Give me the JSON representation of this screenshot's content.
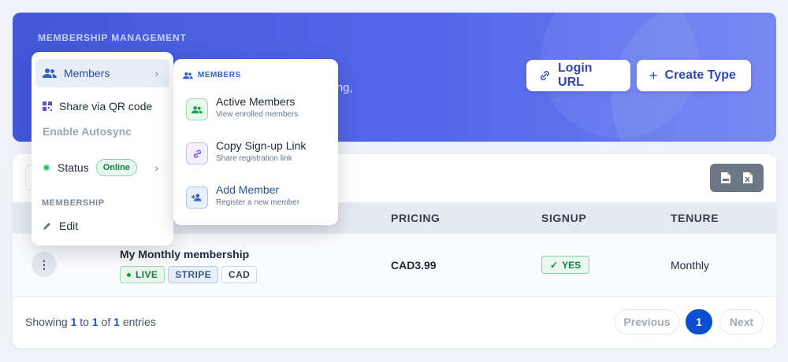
{
  "hero": {
    "eyebrow": "MEMBERSHIP MANAGEMENT",
    "description_fragment": "cing,",
    "login_label": "Login URL",
    "create_label": "Create Type"
  },
  "table": {
    "headers": [
      "PRICING",
      "SIGNUP",
      "TENURE"
    ],
    "rows": [
      {
        "name": "My Monthly membership",
        "badges": [
          "LIVE",
          "STRIPE",
          "CAD"
        ],
        "price": "CAD3.99",
        "signup": "YES",
        "tenure": "Monthly"
      }
    ]
  },
  "footer": {
    "showing_prefix": "Showing",
    "from": "1",
    "to_word": "to",
    "to": "1",
    "of_word": "of",
    "total": "1",
    "entries_word": "entries"
  },
  "pagination": {
    "prev": "Previous",
    "current": "1",
    "next": "Next"
  },
  "context_menu": {
    "members": "Members",
    "share_qr": "Share via QR code",
    "autosync": "Enable Autosync",
    "status": "Status",
    "status_badge": "Online",
    "section_membership": "MEMBERSHIP",
    "edit": "Edit"
  },
  "submenu": {
    "heading": "MEMBERS",
    "items": [
      {
        "title": "Active Members",
        "subtitle": "View enrolled members"
      },
      {
        "title": "Copy Sign-up Link",
        "subtitle": "Share registration link"
      },
      {
        "title": "Add Member",
        "subtitle": "Register a new member"
      }
    ]
  },
  "colors": {
    "hero_start": "#4357d8",
    "accent_blue": "#0b4fd1",
    "success_green": "#15803d"
  }
}
